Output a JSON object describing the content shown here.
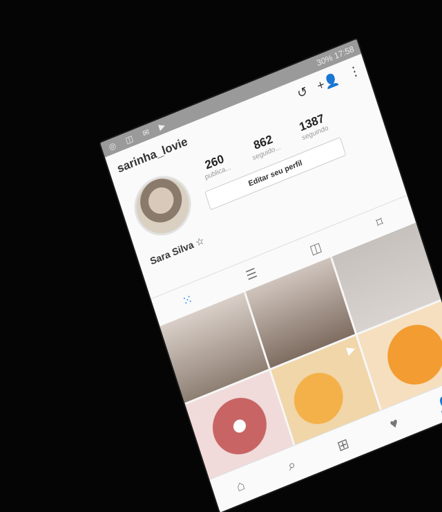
{
  "status_bar": {
    "battery": "30%",
    "time": "17:58"
  },
  "profile": {
    "username": "sarinha_lovie",
    "display_name": "Sara Silva ☆",
    "stats": [
      {
        "value": "260",
        "label": "publica..."
      },
      {
        "value": "862",
        "label": "seguido..."
      },
      {
        "value": "1387",
        "label": "seguindo"
      }
    ],
    "edit_button": "Editar seu perfil"
  },
  "icons": {
    "history": "history-icon",
    "add_user": "add-user-icon",
    "menu": "more-vert-icon",
    "bookmark": "bookmark-icon",
    "tag": "tagged-icon",
    "grid": "grid-icon",
    "list": "list-icon",
    "video": "video-icon",
    "home": "home-icon",
    "search": "search-icon",
    "add": "plus-icon",
    "heart": "heart-icon",
    "profile": "profile-icon"
  },
  "colors": {
    "accent": "#3b90e8"
  }
}
